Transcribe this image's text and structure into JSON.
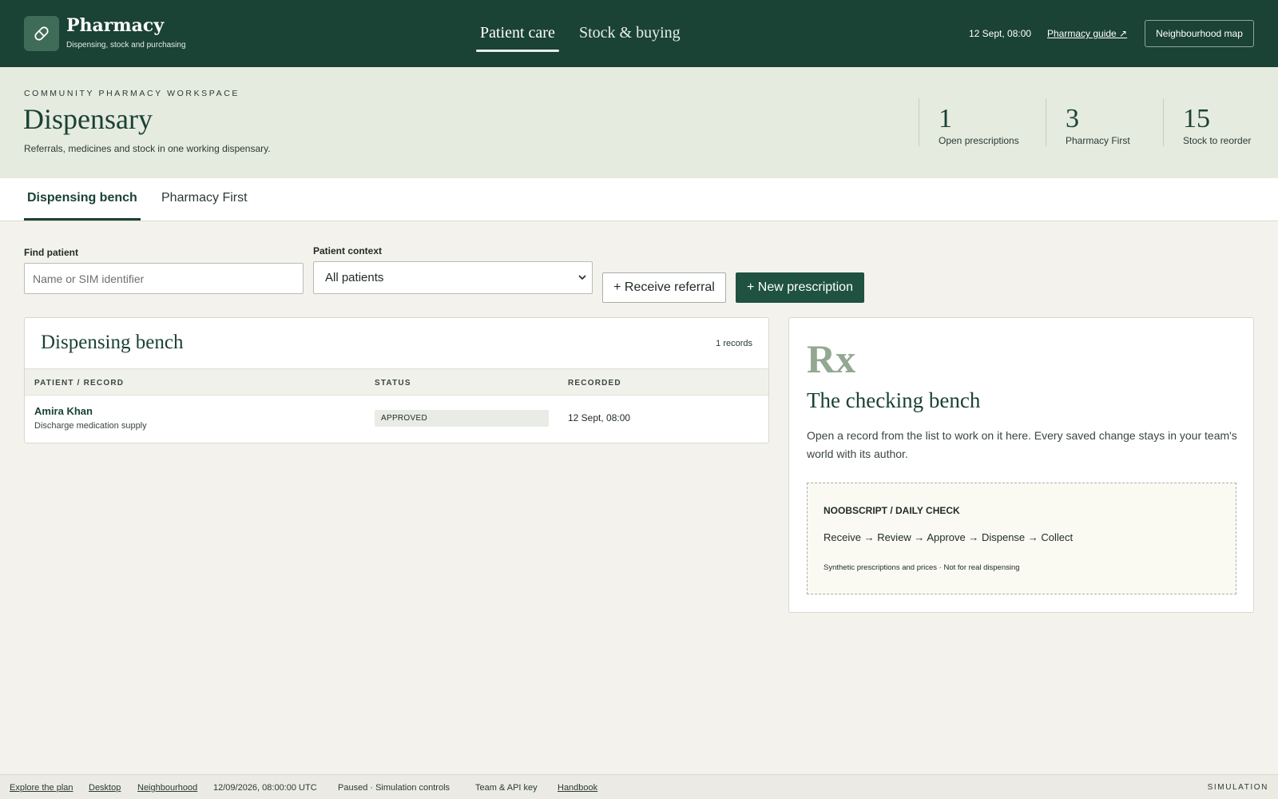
{
  "topbar": {
    "brand_title": "Pharmacy",
    "brand_subtitle": "Dispensing, stock and purchasing",
    "logo_icon": "pill-icon",
    "nav": [
      {
        "label": "Patient care",
        "active": true
      },
      {
        "label": "Stock & buying",
        "active": false
      }
    ],
    "datetime": "12 Sept, 08:00",
    "guide_link": "Pharmacy guide ↗",
    "map_button": "Neighbourhood map"
  },
  "header": {
    "eyebrow": "COMMUNITY PHARMACY WORKSPACE",
    "title": "Dispensary",
    "description": "Referrals, medicines and stock in one working dispensary.",
    "stats": [
      {
        "value": "1",
        "label": "Open prescriptions"
      },
      {
        "value": "3",
        "label": "Pharmacy First"
      },
      {
        "value": "15",
        "label": "Stock to reorder"
      }
    ]
  },
  "tabs": [
    {
      "label": "Dispensing bench",
      "active": true
    },
    {
      "label": "Pharmacy First",
      "active": false
    }
  ],
  "filters": {
    "find_label": "Find patient",
    "find_placeholder": "Name or SIM identifier",
    "context_label": "Patient context",
    "context_value": "All patients",
    "receive_button": "+ Receive referral",
    "new_button": "+ New prescription"
  },
  "bench": {
    "title": "Dispensing bench",
    "count": "1 records",
    "columns": [
      "PATIENT / RECORD",
      "STATUS",
      "RECORDED"
    ],
    "rows": [
      {
        "name": "Amira Khan",
        "detail": "Discharge medication supply",
        "status": "APPROVED",
        "recorded": "12 Sept, 08:00"
      }
    ]
  },
  "side": {
    "mark": "Rx",
    "title": "The checking bench",
    "text": "Open a record from the list to work on it here. Every saved change stays in your team's world with its author.",
    "note_heading": "NOOBSCRIPT / DAILY CHECK",
    "note_flow": "Receive → Review → Approve → Dispense → Collect",
    "note_footer": "Synthetic prescriptions and prices · Not for real dispensing"
  },
  "footer": {
    "links": [
      "Explore the plan",
      "Desktop",
      "Neighbourhood"
    ],
    "timestamp": "12/09/2026, 08:00:00 UTC",
    "sim_status": "Paused · Simulation controls",
    "team": "Team & API key",
    "handbook": "Handbook",
    "mode": "SIMULATION"
  },
  "colors": {
    "brand_dark": "#1a4235",
    "header_band": "#e6ebdf",
    "primary_button": "#1f5240",
    "page_bg": "#f4f2ec"
  }
}
